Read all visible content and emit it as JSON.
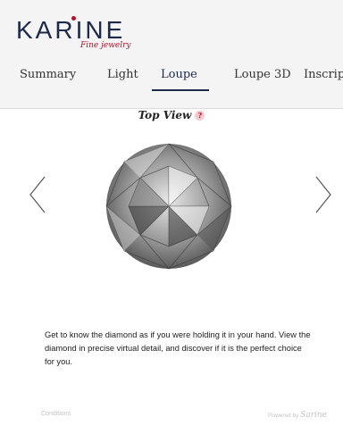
{
  "brand": {
    "name": "KARINE",
    "tagline": "Fine jewelry"
  },
  "tabs": [
    {
      "label": "Summary"
    },
    {
      "label": "Light"
    },
    {
      "label": "Loupe"
    },
    {
      "label": "Loupe 3D"
    },
    {
      "label": "Inscrip"
    }
  ],
  "active_tab": "Loupe",
  "viewer": {
    "title": "Top View",
    "help": "?"
  },
  "description": "Get to know the diamond as if you were holding it in your hand. View the diamond in precise virtual detail, and discover if it is the perfect choice for you.",
  "footer": {
    "conditions": "Conditions",
    "powered_by": "Powered by",
    "powered_brand": "Sarine"
  },
  "colors": {
    "brand_navy": "#1e2a4a",
    "brand_red": "#b0122b",
    "header_bg": "#f4f4f4"
  }
}
